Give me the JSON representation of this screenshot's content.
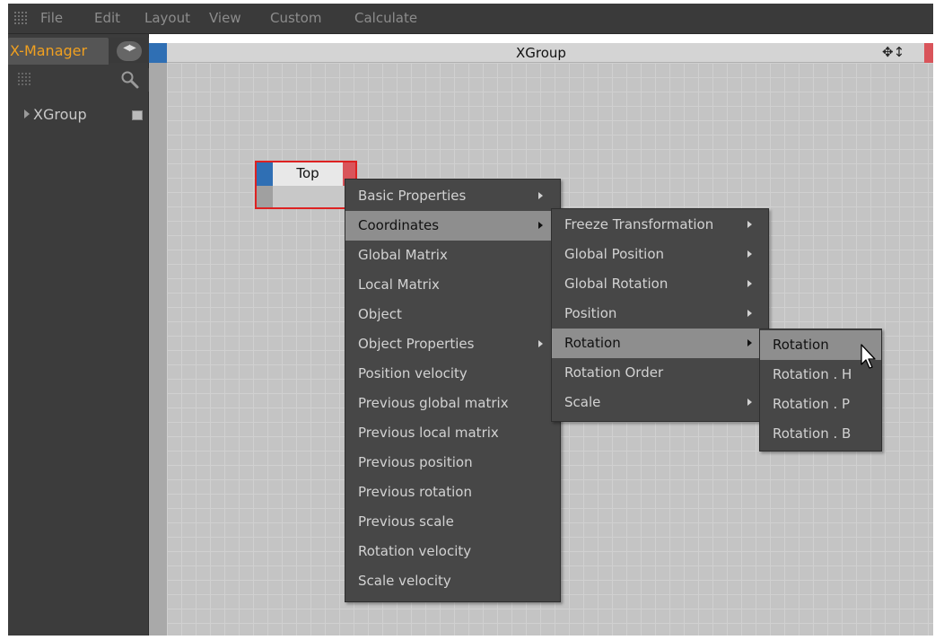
{
  "menubar": {
    "items": [
      "File",
      "Edit",
      "Layout",
      "View",
      "Custom",
      "Calculate"
    ]
  },
  "xmanager": {
    "tab_label": "X-Manager",
    "tree_item": "XGroup"
  },
  "editor": {
    "title": "XGroup",
    "node_title": "Top"
  },
  "menu1": {
    "items": [
      "Basic Properties",
      "Coordinates",
      "Global Matrix",
      "Local Matrix",
      "Object",
      "Object Properties",
      "Position velocity",
      "Previous global matrix",
      "Previous local matrix",
      "Previous position",
      "Previous rotation",
      "Previous scale",
      "Rotation velocity",
      "Scale velocity"
    ],
    "selected": "Coordinates"
  },
  "menu2": {
    "items": [
      "Freeze Transformation",
      "Global Position",
      "Global Rotation",
      "Position",
      "Rotation",
      "Rotation Order",
      "Scale"
    ],
    "selected": "Rotation"
  },
  "menu3": {
    "items": [
      "Rotation",
      "Rotation . H",
      "Rotation . P",
      "Rotation . B"
    ],
    "selected": "Rotation"
  },
  "colors": {
    "accent_orange": "#f0a020",
    "port_blue": "#2f6fb4",
    "port_red": "#d9545a",
    "node_selection": "#dd2222",
    "menu_bg": "#474747",
    "menu_highlight": "#8e8e8e"
  },
  "icons": {
    "menubar_grip": "grip-icon",
    "search": "search-icon",
    "tab_arrows": "left-right-arrows-icon",
    "tree_expand": "expand-arrow-icon",
    "tree_node": "xgroup-node-icon",
    "submenu": "submenu-arrow-icon",
    "header_move": "move-icon",
    "cursor": "mouse-pointer-icon"
  }
}
